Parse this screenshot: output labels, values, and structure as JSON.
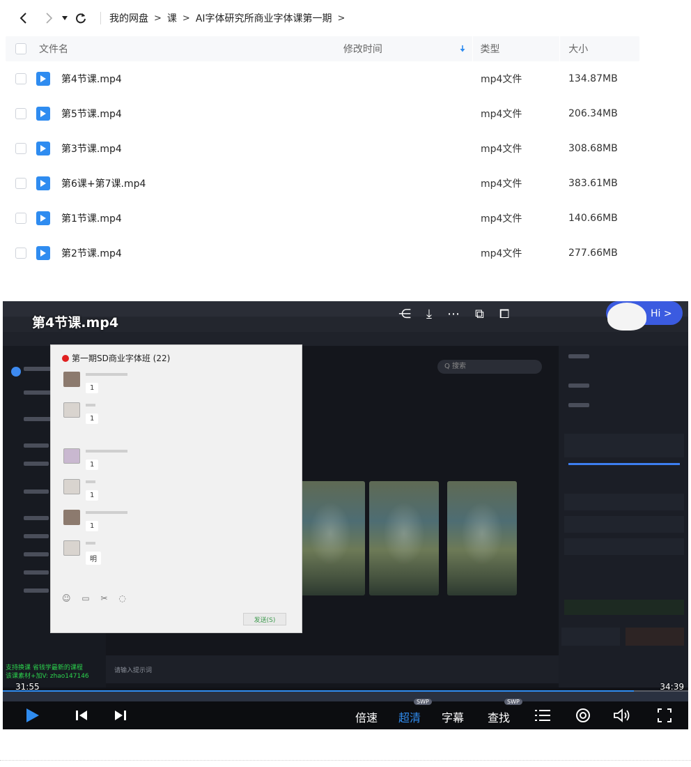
{
  "nav": {
    "back_icon": "chevron-left-icon",
    "forward_icon": "chevron-right-icon",
    "dropdown_icon": "caret-down-icon",
    "refresh_icon": "refresh-icon",
    "breadcrumbs": [
      "我的网盘",
      "课",
      "AI字体研究所商业字体课第一期"
    ]
  },
  "table": {
    "headers": {
      "name": "文件名",
      "time": "修改时间",
      "type": "类型",
      "size": "大小"
    },
    "sort_icon": "arrow-down-icon",
    "rows": [
      {
        "name": "第4节课.mp4",
        "type": "mp4文件",
        "size": "134.87MB"
      },
      {
        "name": "第5节课.mp4",
        "type": "mp4文件",
        "size": "206.34MB"
      },
      {
        "name": "第3节课.mp4",
        "type": "mp4文件",
        "size": "308.68MB"
      },
      {
        "name": "第6课+第7课.mp4",
        "type": "mp4文件",
        "size": "383.61MB"
      },
      {
        "name": "第1节课.mp4",
        "type": "mp4文件",
        "size": "140.66MB"
      },
      {
        "name": "第2节课.mp4",
        "type": "mp4文件",
        "size": "277.66MB"
      }
    ],
    "accent": "#2f8cf0"
  },
  "player": {
    "title": "第4节课.mp4",
    "chat_title": "第一期SD商业字体班 (22)",
    "chat_messages": [
      "1",
      "1",
      "1",
      "1",
      "1",
      "明"
    ],
    "chat_send": "发送(S)",
    "app_search": "Q 搜索",
    "prompt_placeholder": "请输入提示词",
    "watermark_line1": "支持换课 省钱学最新的课程",
    "watermark_line2": "该课素材+加V: zhao147146",
    "hi_label": "Hi >",
    "time_current": "31:55",
    "time_total": "34:39",
    "progress": 0.921,
    "controls": {
      "speed": "倍速",
      "quality": "超清",
      "subtitle": "字幕",
      "find": "查找",
      "swp": "SWP"
    }
  }
}
